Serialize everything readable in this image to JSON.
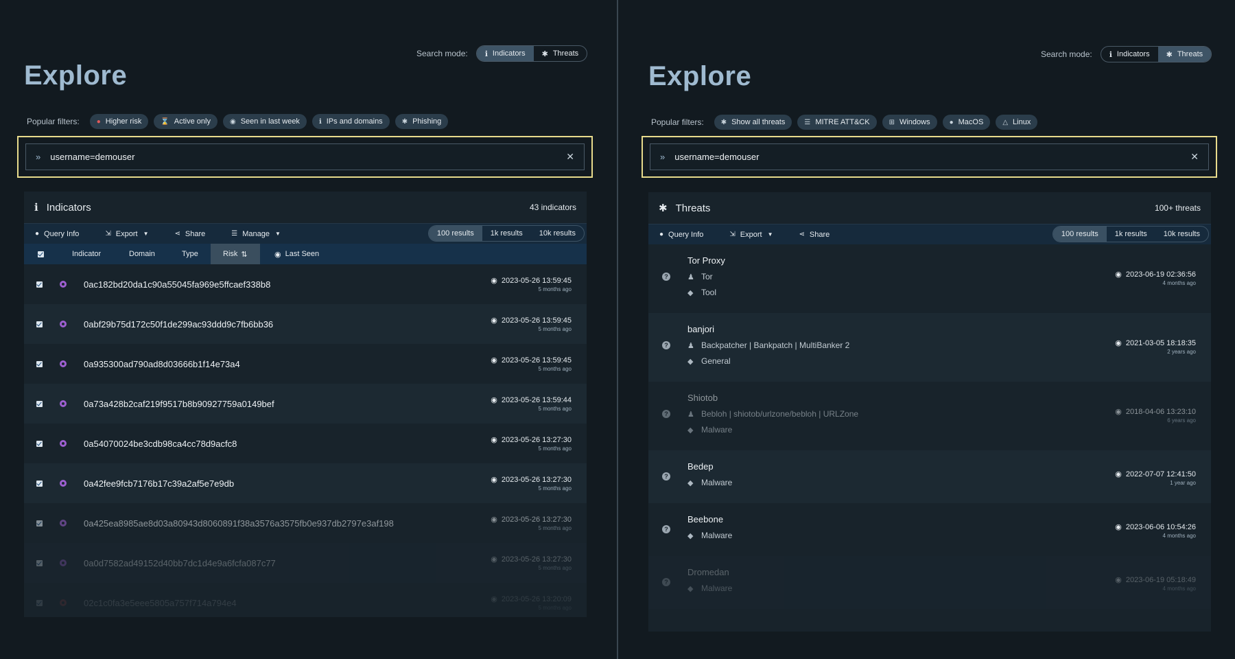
{
  "left": {
    "search_mode_label": "Search mode:",
    "search_modes": [
      {
        "label": "Indicators",
        "icon": "info-icon",
        "active": true
      },
      {
        "label": "Threats",
        "icon": "bug-icon",
        "active": false
      }
    ],
    "title": "Explore",
    "filters_label": "Popular filters:",
    "filters": [
      {
        "label": "Higher risk",
        "icon": "risk-icon"
      },
      {
        "label": "Active only",
        "icon": "hourglass-icon"
      },
      {
        "label": "Seen in last week",
        "icon": "eye-icon"
      },
      {
        "label": "IPs and domains",
        "icon": "info-icon"
      },
      {
        "label": "Phishing",
        "icon": "bug-icon"
      }
    ],
    "search_value": "username=demouser",
    "card": {
      "title": "Indicators",
      "count": "43 indicators",
      "toolbar": {
        "query_info": "Query Info",
        "export": "Export",
        "share": "Share",
        "manage": "Manage"
      },
      "results": [
        "100 results",
        "1k results",
        "10k results"
      ],
      "columns": {
        "indicator": "Indicator",
        "domain": "Domain",
        "type": "Type",
        "risk": "Risk",
        "last_seen": "Last Seen"
      },
      "rows": [
        {
          "hash": "0ac182bd20da1c90a55045fa969e5ffcaef338b8",
          "date": "2023-05-26 13:59:45",
          "ago": "5 months ago"
        },
        {
          "hash": "0abf29b75d172c50f1de299ac93ddd9c7fb6bb36",
          "date": "2023-05-26 13:59:45",
          "ago": "5 months ago"
        },
        {
          "hash": "0a935300ad790ad8d03666b1f14e73a4",
          "date": "2023-05-26 13:59:45",
          "ago": "5 months ago"
        },
        {
          "hash": "0a73a428b2caf219f9517b8b90927759a0149bef",
          "date": "2023-05-26 13:59:44",
          "ago": "5 months ago"
        },
        {
          "hash": "0a54070024be3cdb98ca4cc78d9acfc8",
          "date": "2023-05-26 13:27:30",
          "ago": "5 months ago"
        },
        {
          "hash": "0a42fee9fcb7176b17c39a2af5e7e9db",
          "date": "2023-05-26 13:27:30",
          "ago": "5 months ago"
        },
        {
          "hash": "0a425ea8985ae8d03a80943d8060891f38a3576a3575fb0e937db2797e3af198",
          "date": "2023-05-26 13:27:30",
          "ago": "5 months ago"
        },
        {
          "hash": "0a0d7582ad49152d40bb7dc1d4e9a6fcfa087c77",
          "date": "2023-05-26 13:27:30",
          "ago": "5 months ago"
        },
        {
          "hash": "02c1c0fa3e5eee5805a757f714a794e4",
          "date": "2023-05-26 13:20:09",
          "ago": "5 months ago"
        }
      ]
    }
  },
  "right": {
    "search_mode_label": "Search mode:",
    "search_modes": [
      {
        "label": "Indicators",
        "icon": "info-icon",
        "active": false
      },
      {
        "label": "Threats",
        "icon": "bug-icon",
        "active": true
      }
    ],
    "title": "Explore",
    "filters_label": "Popular filters:",
    "filters": [
      {
        "label": "Show all threats",
        "icon": "bug-icon"
      },
      {
        "label": "MITRE ATT&CK",
        "icon": "list-icon"
      },
      {
        "label": "Windows",
        "icon": "windows-icon"
      },
      {
        "label": "MacOS",
        "icon": "apple-icon"
      },
      {
        "label": "Linux",
        "icon": "linux-icon"
      }
    ],
    "search_value": "username=demouser",
    "card": {
      "title": "Threats",
      "count": "100+ threats",
      "toolbar": {
        "query_info": "Query Info",
        "export": "Export",
        "share": "Share"
      },
      "results": [
        "100 results",
        "1k results",
        "10k results"
      ],
      "rows": [
        {
          "name": "Tor Proxy",
          "aliases": "Tor",
          "tag": "Tool",
          "date": "2023-06-19 02:36:56",
          "ago": "4 months ago"
        },
        {
          "name": "banjori",
          "aliases": "Backpatcher | Bankpatch | MultiBanker 2",
          "tag": "General",
          "date": "2021-03-05 18:18:35",
          "ago": "2 years ago"
        },
        {
          "name": "Shiotob",
          "aliases": "Bebloh | shiotob/urlzone/bebloh | URLZone",
          "tag": "Malware",
          "date": "2018-04-06 13:23:10",
          "ago": "6 years ago"
        },
        {
          "name": "Bedep",
          "aliases": "",
          "tag": "Malware",
          "date": "2022-07-07 12:41:50",
          "ago": "1 year ago"
        },
        {
          "name": "Beebone",
          "aliases": "",
          "tag": "Malware",
          "date": "2023-06-06 10:54:26",
          "ago": "4 months ago"
        },
        {
          "name": "Dromedan",
          "aliases": "",
          "tag": "Malware",
          "date": "2023-06-19 05:18:49",
          "ago": "4 months ago"
        }
      ]
    }
  }
}
